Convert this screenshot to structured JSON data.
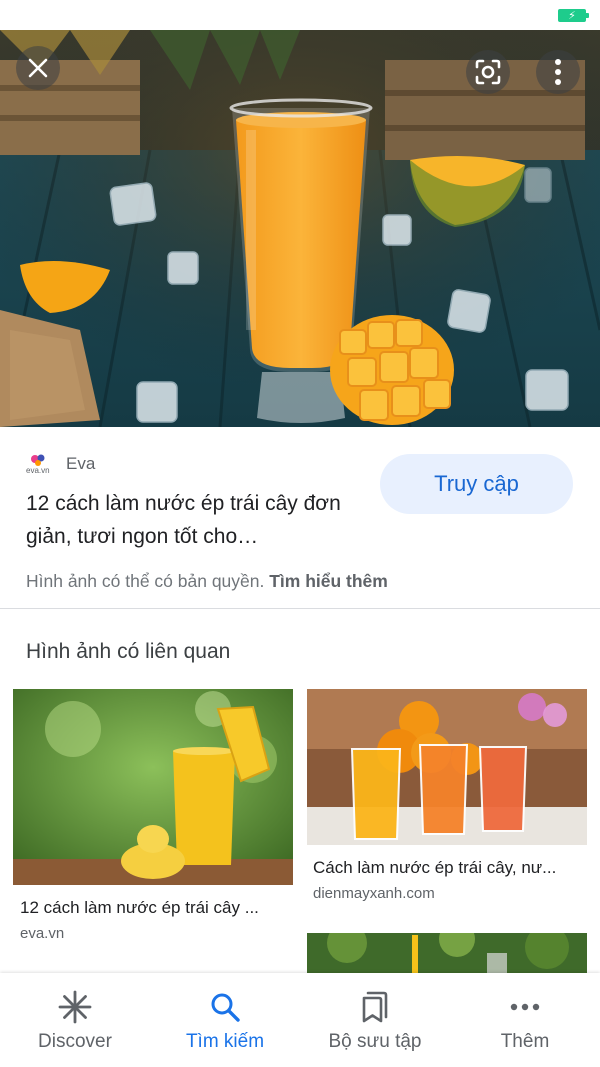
{
  "status_bar": {
    "battery_icon": "battery-charging-icon",
    "battery_color": "#1ecc8c"
  },
  "hero": {
    "close_icon": "close-icon",
    "lens_icon": "lens-icon",
    "more_icon": "more-vert-icon"
  },
  "result": {
    "source_logo_text": "eva.vn",
    "source_name": "Eva",
    "title": "12 cách làm nước ép trái cây đơn giản, tươi ngon tốt cho…",
    "visit_label": "Truy cập",
    "copyright_text": "Hình ảnh có thể có bản quyền. ",
    "learn_more": "Tìm hiểu thêm"
  },
  "related": {
    "heading": "Hình ảnh có liên quan",
    "items": [
      {
        "title": "12 cách làm nước ép trái cây ...",
        "site": "eva.vn"
      },
      {
        "title": "Cách làm nước ép trái cây, nư...",
        "site": "dienmayxanh.com"
      },
      {
        "title": "",
        "site": ""
      }
    ]
  },
  "bottom_nav": {
    "items": [
      {
        "label": "Discover",
        "icon": "asterisk-icon",
        "active": false
      },
      {
        "label": "Tìm kiếm",
        "icon": "search-icon",
        "active": true
      },
      {
        "label": "Bộ sưu tập",
        "icon": "collections-icon",
        "active": false
      },
      {
        "label": "Thêm",
        "icon": "more-horiz-icon",
        "active": false
      }
    ]
  },
  "colors": {
    "accent": "#1a73e8",
    "visit_button_bg": "#e8f0fe",
    "visit_button_text": "#1967d2"
  }
}
